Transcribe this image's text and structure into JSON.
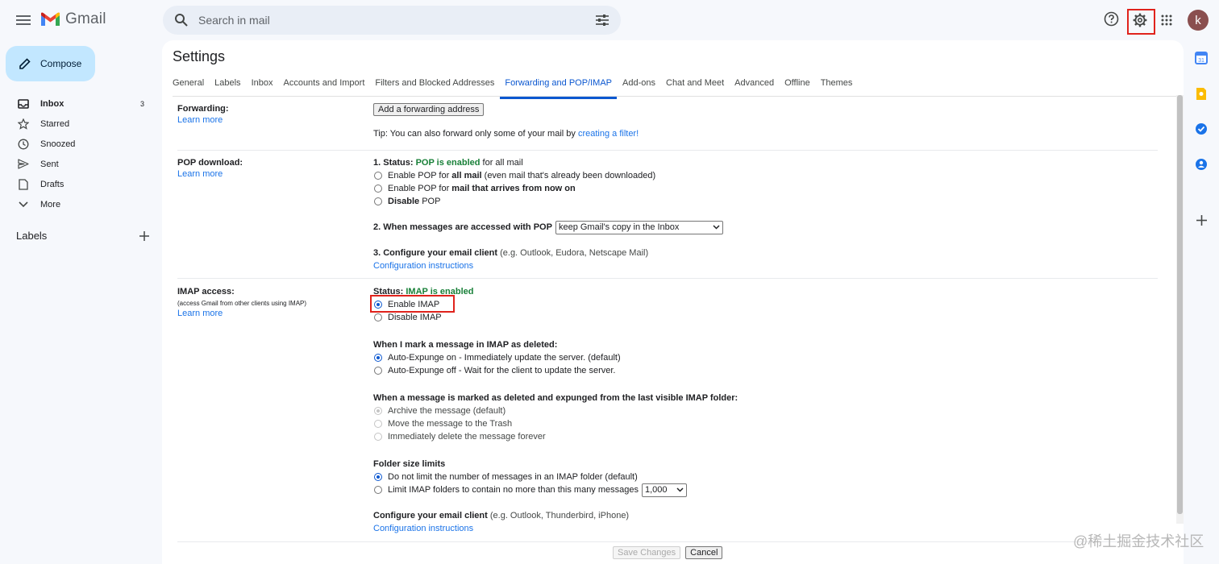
{
  "app": {
    "name": "Gmail",
    "search": {
      "placeholder": "Search in mail"
    },
    "avatar_letter": "k"
  },
  "sidebar": {
    "compose_label": "Compose",
    "items": [
      {
        "label": "Inbox",
        "count": "3",
        "icon": "inbox-icon",
        "active": true
      },
      {
        "label": "Starred",
        "icon": "star-icon"
      },
      {
        "label": "Snoozed",
        "icon": "clock-icon"
      },
      {
        "label": "Sent",
        "icon": "send-icon"
      },
      {
        "label": "Drafts",
        "icon": "draft-icon"
      },
      {
        "label": "More",
        "icon": "chevron-down-icon"
      }
    ],
    "labels_title": "Labels"
  },
  "settings": {
    "title": "Settings",
    "tabs": [
      "General",
      "Labels",
      "Inbox",
      "Accounts and Import",
      "Filters and Blocked Addresses",
      "Forwarding and POP/IMAP",
      "Add-ons",
      "Chat and Meet",
      "Advanced",
      "Offline",
      "Themes"
    ],
    "active_tab": "Forwarding and POP/IMAP",
    "learn_more": "Learn more",
    "forwarding": {
      "label": "Forwarding:",
      "add_button": "Add a forwarding address",
      "tip_prefix": "Tip: You can also forward only some of your mail by ",
      "tip_link": "creating a filter!"
    },
    "pop": {
      "label": "POP download:",
      "status_prefix": "1. Status: ",
      "status_value": "POP is enabled",
      "status_suffix": " for all mail",
      "opt1_prefix": "Enable POP for ",
      "opt1_bold": "all mail",
      "opt1_suffix": " (even mail that's already been downloaded)",
      "opt2_prefix": "Enable POP for ",
      "opt2_bold": "mail that arrives from now on",
      "opt3_bold": "Disable",
      "opt3_suffix": " POP",
      "q2": "2. When messages are accessed with POP",
      "q2_select": "keep Gmail's copy in the Inbox",
      "q3_bold": "3. Configure your email client",
      "q3_suffix": " (e.g. Outlook, Eudora, Netscape Mail)",
      "config_link": "Configuration instructions"
    },
    "imap": {
      "label": "IMAP access:",
      "note": "(access Gmail from other clients using IMAP)",
      "status_prefix": "Status: ",
      "status_value": "IMAP is enabled",
      "enable": "Enable IMAP",
      "disable": "Disable IMAP",
      "deleted_title": "When I mark a message in IMAP as deleted:",
      "expunge_on": "Auto-Expunge on - Immediately update the server. (default)",
      "expunge_off": "Auto-Expunge off - Wait for the client to update the server.",
      "expunged_title": "When a message is marked as deleted and expunged from the last visible IMAP folder:",
      "archive": "Archive the message (default)",
      "trash": "Move the message to the Trash",
      "delete_forever": "Immediately delete the message forever",
      "folder_title": "Folder size limits",
      "no_limit": "Do not limit the number of messages in an IMAP folder (default)",
      "limit": "Limit IMAP folders to contain no more than this many messages",
      "limit_select": "1,000",
      "configure_bold": "Configure your email client",
      "configure_suffix": " (e.g. Outlook, Thunderbird, iPhone)",
      "config_link": "Configuration instructions"
    },
    "save_button": "Save Changes",
    "cancel_button": "Cancel"
  },
  "watermark": "@稀土掘金技术社区",
  "colors": {
    "accent": "#0b57d0",
    "compose": "#c2e7ff",
    "highlight": "#e0231c",
    "status_green": "#188038"
  }
}
